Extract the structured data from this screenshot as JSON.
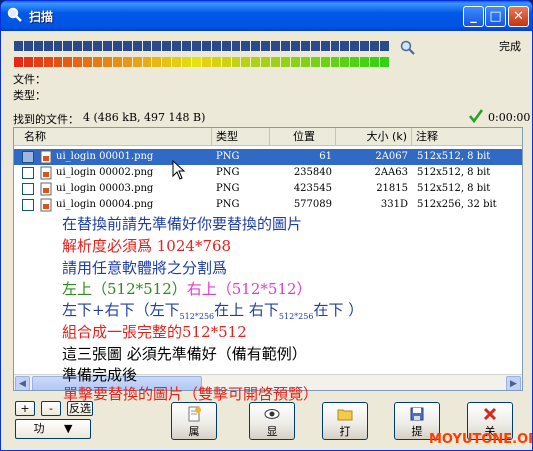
{
  "window": {
    "title": "扫描",
    "controls": {
      "minimize": "_",
      "maximize": "□",
      "close": "✕"
    }
  },
  "status": {
    "done_label": "完成",
    "elapsed": "0:00:00"
  },
  "fields": {
    "file_label": "文件：",
    "type_label": "类型："
  },
  "found": {
    "label": "找到的文件：",
    "value": "4 (486 kB, 497 148 B)"
  },
  "table": {
    "columns": [
      "名称",
      "类型",
      "位置",
      "大小 (k)",
      "注释"
    ],
    "rows": [
      {
        "name": "ui_login 00001.png",
        "type": "PNG",
        "position": "61",
        "size": "2A067",
        "note": "512x512, 8 bit",
        "selected": true
      },
      {
        "name": "ui_login 00002.png",
        "type": "PNG",
        "position": "235840",
        "size": "2AA63",
        "note": "512x512, 8 bit",
        "selected": false
      },
      {
        "name": "ui_login 00003.png",
        "type": "PNG",
        "position": "423545",
        "size": "21815",
        "note": "512x512, 8 bit",
        "selected": false
      },
      {
        "name": "ui_login 00004.png",
        "type": "PNG",
        "position": "577089",
        "size": "331D",
        "note": "512x256, 32 bit",
        "selected": false
      }
    ]
  },
  "overlay": {
    "line1": "在替換前請先準備好你要替換的圖片",
    "line2": "解析度必須爲 1024*768",
    "line3": "請用任意軟體將之分割爲",
    "line4a": "左上（512*512）",
    "line4b": "右上（512*512）",
    "line5_p1": "左下+右下（左下",
    "line5_sub1": "512*256",
    "line5_p2": "在上 右下",
    "line5_sub2": "512*256",
    "line5_p3": "在下 ）",
    "line6": "組合成一張完整的512*512",
    "line7": "這三張圖 必須先準備好（備有範例）",
    "line8": "準備完成後",
    "line9": "單擊要替換的圖片（雙擊可開啓預覽）"
  },
  "bottom": {
    "plus": "+",
    "minus": "-",
    "invert": "反选",
    "function_menu": "功",
    "buttons": {
      "properties": "属",
      "show": "显",
      "open": "打",
      "extract": "提",
      "close": "关"
    }
  },
  "watermark": "MOYUTONE.ORG",
  "colors": {
    "titlebar": "#0054e3",
    "selection": "#316ac5",
    "overlay_blue": "#1f3fa8",
    "overlay_red": "#e8201b",
    "overlay_green": "#2e8b1e",
    "overlay_magenta": "#e23bd0",
    "progress_blue": "#2b4a8c"
  },
  "icons": {
    "title": "magnifier-icon",
    "zoom": "zoom-icon",
    "done": "checkmark-icon",
    "file": "png-file-icon"
  }
}
